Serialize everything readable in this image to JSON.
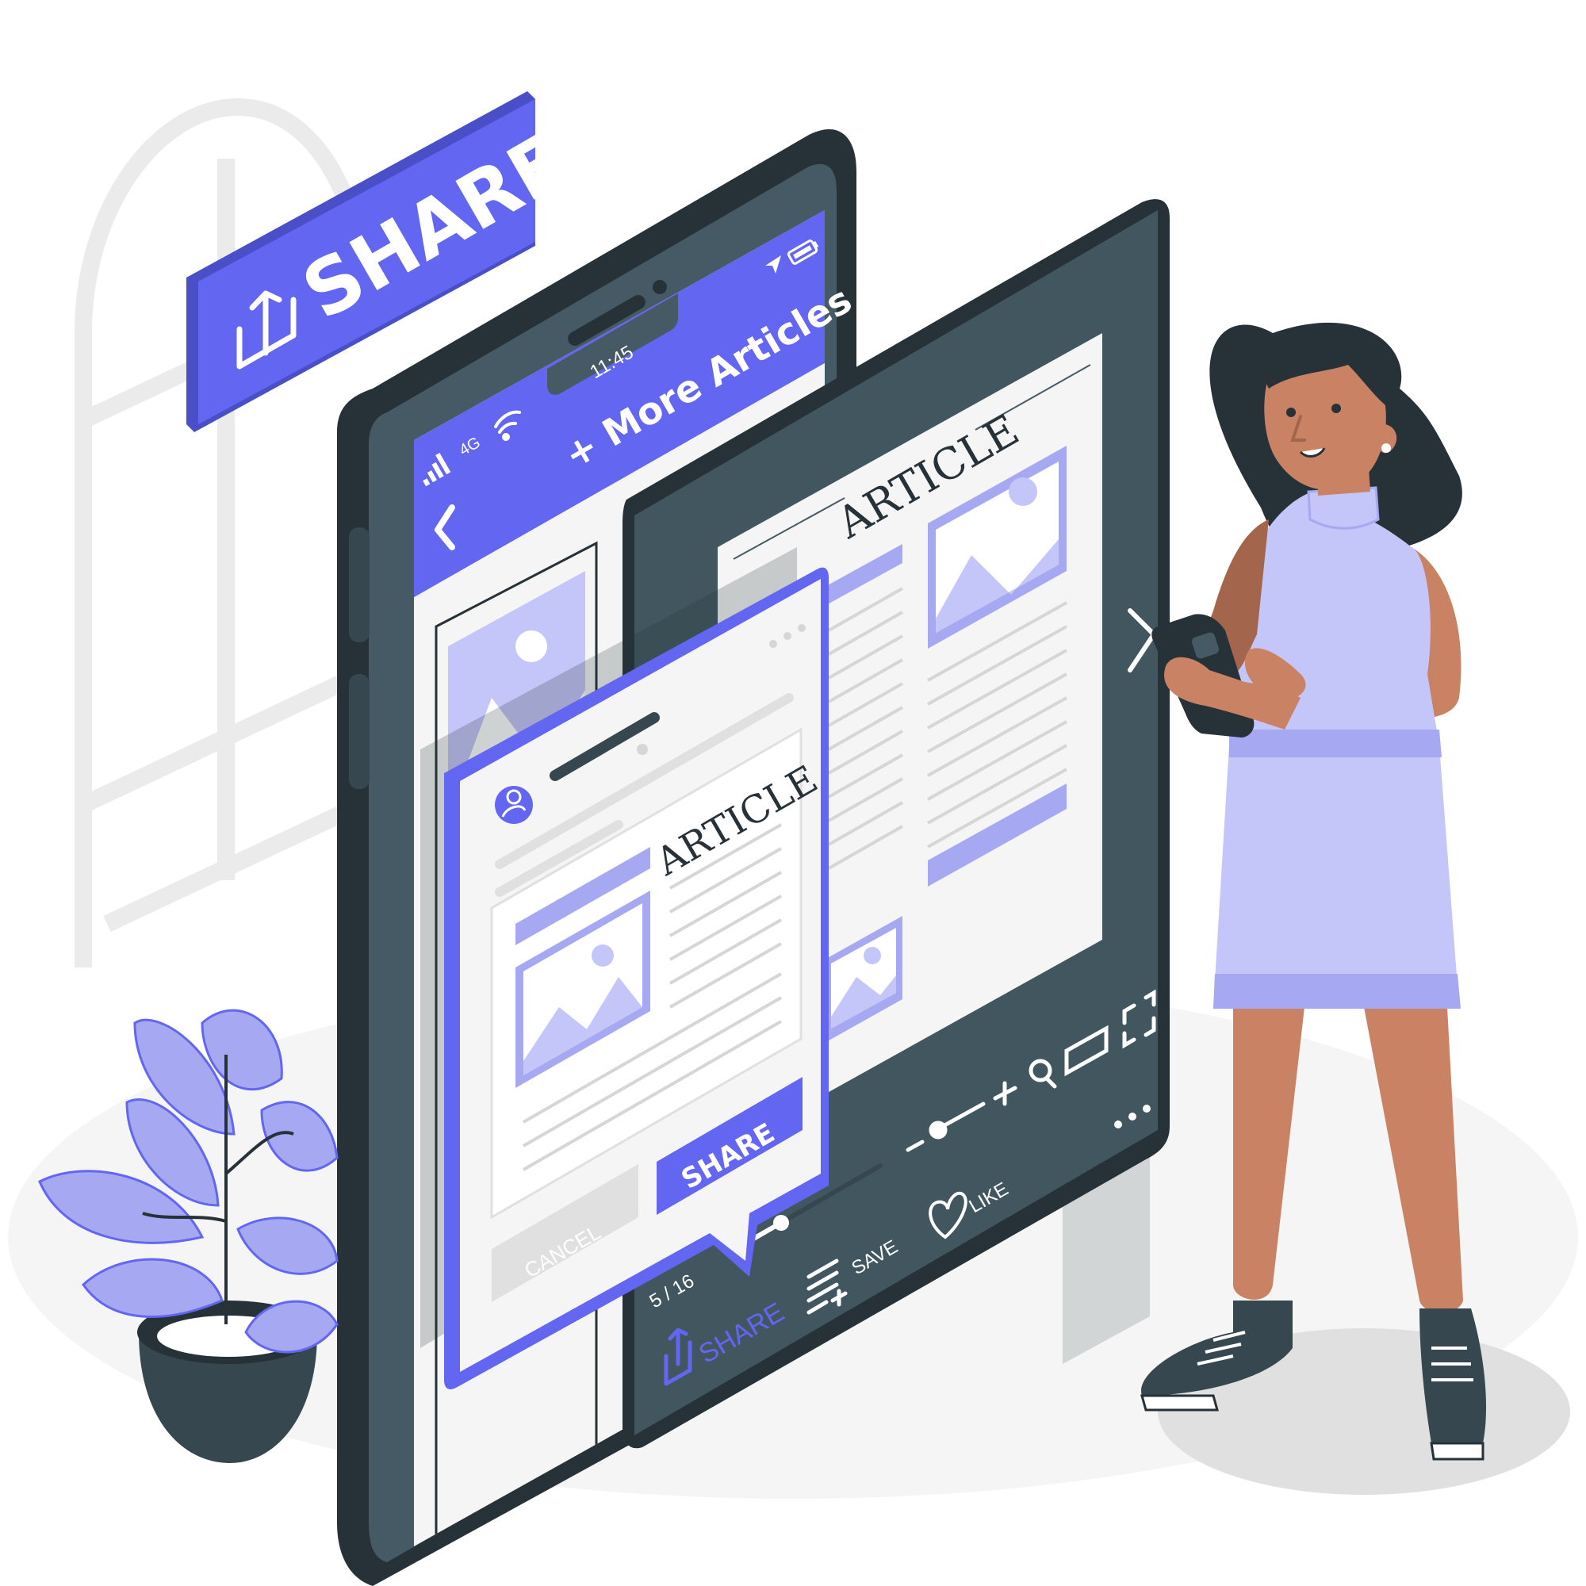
{
  "illustration": {
    "share_sign": {
      "label": "SHARE",
      "icon": "share-upload-icon"
    },
    "phone": {
      "time": "11:45",
      "network": "4G",
      "header_title": "+ More Articles",
      "icons": [
        "signal-bars-icon",
        "wifi-icon",
        "location-arrow-icon",
        "battery-icon",
        "back-chevron-icon"
      ]
    },
    "share_dialog": {
      "article_title": "ARTICLE",
      "share_button": "SHARE",
      "cancel_button": "CANCEL",
      "icons": [
        "avatar-icon",
        "more-dots-icon",
        "image-placeholder-icon"
      ]
    },
    "reader": {
      "article_title": "ARTICLE",
      "page_indicator": "5 / 16",
      "save_label": "SAVE",
      "like_label": "LIKE",
      "share_label": "SHARE",
      "icons": [
        "zoom-in-icon",
        "zoom-out-icon",
        "search-icon",
        "landscape-icon",
        "fullscreen-icon",
        "more-dots-icon",
        "heart-icon",
        "save-list-icon",
        "share-upload-icon",
        "next-arrow-icon"
      ]
    },
    "colors": {
      "accent": "#6366F1",
      "accent_light": "#C4C6F9",
      "accent_mid": "#A6A9F2",
      "dark": "#263238",
      "dark_gray": "#455A64",
      "skin": "#C98263",
      "light_gray": "#EBEBEB",
      "screen_bg": "#F5F5F5"
    }
  }
}
